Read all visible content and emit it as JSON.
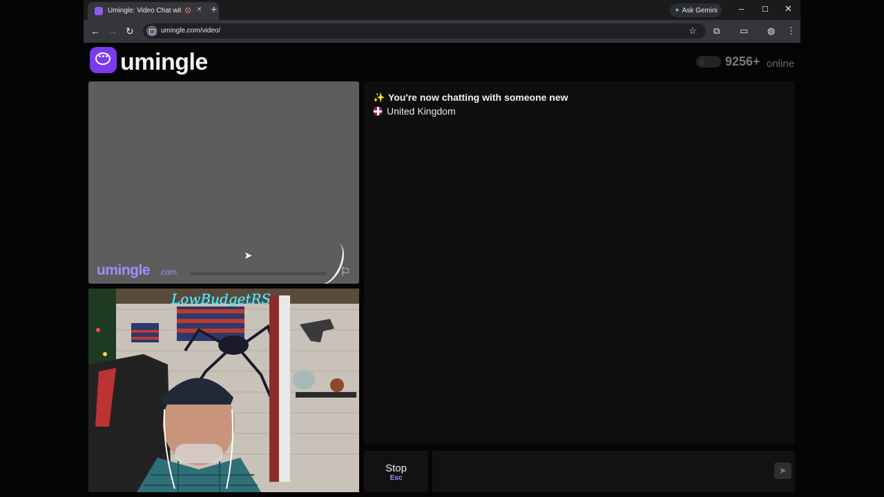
{
  "browser": {
    "tab_title": "Umingle: Video Chat with S",
    "tab_close": "×",
    "new_tab": "+",
    "ask_gemini": "Ask Gemini",
    "url": "umingle.com/video/",
    "window_minimize": "–",
    "window_maximize": "☐",
    "window_close": "✕"
  },
  "header": {
    "brand": "umingle",
    "online_count": "9256+",
    "online_label": "online"
  },
  "stranger_video": {
    "watermark": "umingle",
    "watermark_suffix": ".com"
  },
  "chat": {
    "messages": [
      "You're now chatting with someone new",
      "United Kingdom"
    ]
  },
  "controls": {
    "stop_label": "Stop",
    "stop_hint": "Esc",
    "message_placeholder": ""
  },
  "colors": {
    "accent": "#7c3aed",
    "accent_light": "#a78bfa"
  }
}
